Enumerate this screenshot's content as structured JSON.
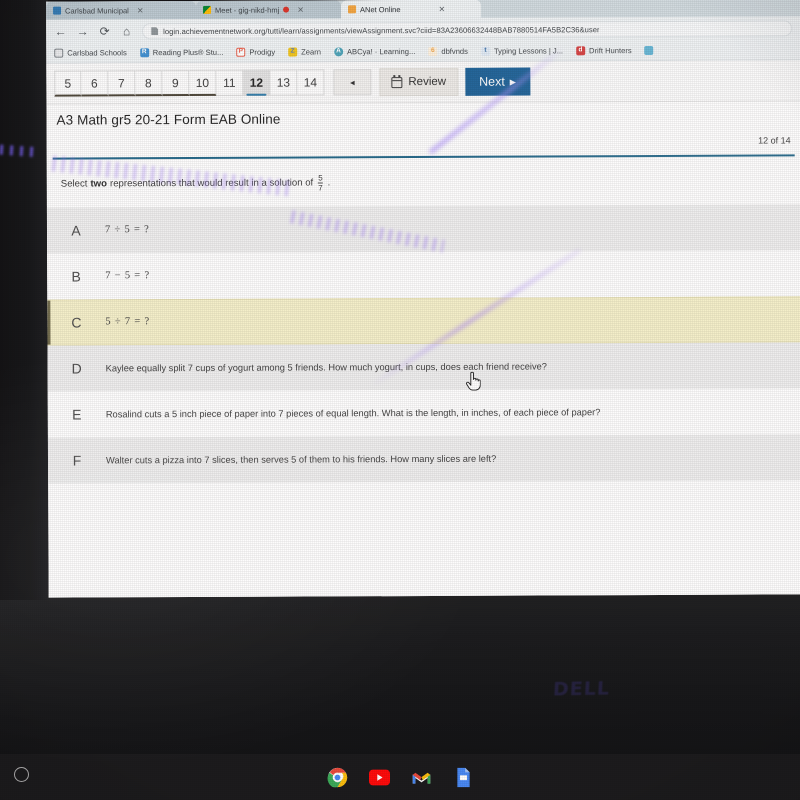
{
  "browser": {
    "tabs": [
      {
        "label": "Carlsbad Municipal",
        "favicon": "globe-icon",
        "active": false,
        "color": "#2f7ab5"
      },
      {
        "label": "Meet - gig-nikd-hmj",
        "favicon": "google-meet-icon",
        "active": false,
        "color": "#00832d",
        "recording_dot": true
      },
      {
        "label": "ANet Online",
        "favicon": "anet-icon",
        "active": true,
        "color": "#f2a33c"
      }
    ],
    "nav": {
      "back_icon": "back-arrow-icon",
      "forward_icon": "forward-arrow-icon",
      "reload_icon": "reload-icon",
      "home_icon": "home-icon"
    },
    "omnibox": {
      "page_info_icon": "page-info-icon",
      "url": "login.achievementnetwork.org/tutti/learn/assignments/viewAssignment.svc?ciid=83A23606632448BAB7880514FA5B2C36&user"
    },
    "bookmarks": [
      {
        "label": "Carlsbad Schools",
        "icon": "folder-icon",
        "color": "#6b7378",
        "glyph": ""
      },
      {
        "label": "Reading Plus® Stu...",
        "icon": "reading-plus-icon",
        "color": "#3d8fd1",
        "glyph": "R"
      },
      {
        "label": "Prodigy",
        "icon": "prodigy-icon",
        "color": "#e8604c",
        "glyph": "P"
      },
      {
        "label": "Zearn",
        "icon": "zearn-icon",
        "color": "#f0c419",
        "glyph": "Z"
      },
      {
        "label": "ABCya! · Learning...",
        "icon": "abcya-icon",
        "color": "#4aa3b8",
        "glyph": "A"
      },
      {
        "label": "dbfvnds",
        "icon": "dbfvnds-icon",
        "color": "#f3a84c",
        "glyph": "6"
      },
      {
        "label": "Typing Lessons | J...",
        "icon": "typing-lessons-icon",
        "color": "#4a90d9",
        "glyph": "t"
      },
      {
        "label": "Drift Hunters",
        "icon": "drift-hunters-icon",
        "color": "#d43c3c",
        "glyph": "d"
      },
      {
        "label": "",
        "icon": "extra-bookmark-icon",
        "color": "#5fb3d4",
        "glyph": ""
      }
    ]
  },
  "assignment": {
    "title": "A3 Math gr5 20-21 Form EAB Online",
    "counter": "12 of 14",
    "question_numbers": [
      {
        "label": "5",
        "state": "done"
      },
      {
        "label": "6",
        "state": "done"
      },
      {
        "label": "7",
        "state": "done"
      },
      {
        "label": "8",
        "state": "done"
      },
      {
        "label": "9",
        "state": "done"
      },
      {
        "label": "10",
        "state": "done"
      },
      {
        "label": "11",
        "state": "default"
      },
      {
        "label": "12",
        "state": "current"
      },
      {
        "label": "13",
        "state": "default"
      },
      {
        "label": "14",
        "state": "default"
      }
    ],
    "prev_button": {
      "label": "◂",
      "name": "previous-page-button"
    },
    "review_button": {
      "label": "Review",
      "icon": "calendar-grid-icon"
    },
    "next_button": {
      "label": "Next",
      "icon": "next-arrow-icon",
      "color": "#1a5f96"
    }
  },
  "question": {
    "stem_before": "Select",
    "stem_bold": "two",
    "stem_after": "representations that would result in a solution of",
    "fraction_numerator": "5",
    "fraction_denominator": "7",
    "stem_end": ".",
    "options": [
      {
        "letter": "A",
        "text": "7 ÷ 5 = ?",
        "style": "math",
        "row": "shade"
      },
      {
        "letter": "B",
        "text": "7 − 5 = ?",
        "style": "math",
        "row": "plain"
      },
      {
        "letter": "C",
        "text": "5 ÷ 7 = ?",
        "style": "math",
        "row": "hover"
      },
      {
        "letter": "D",
        "text": "Kaylee equally split 7 cups of yogurt among 5 friends. How much yogurt, in cups, does each friend receive?",
        "style": "prose",
        "row": "shade"
      },
      {
        "letter": "E",
        "text": "Rosalind cuts a 5 inch piece of paper into 7 pieces of equal length. What is the length, in inches, of each piece of paper?",
        "style": "prose",
        "row": "plain"
      },
      {
        "letter": "F",
        "text": "Walter cuts a pizza into 7 slices, then serves 5 of them to his friends. How many slices are left?",
        "style": "prose",
        "row": "shade"
      }
    ]
  },
  "cursor": {
    "type": "pointing-hand-cursor",
    "over_option": "C"
  },
  "shelf": {
    "launcher_icon": "launcher-circle-icon",
    "apps": [
      {
        "name": "chrome-icon",
        "label": "Chrome",
        "active": true
      },
      {
        "name": "youtube-icon",
        "label": "YouTube",
        "active": false
      },
      {
        "name": "gmail-icon",
        "label": "Gmail",
        "active": false
      },
      {
        "name": "slides-icon",
        "label": "Slides",
        "active": false
      }
    ]
  },
  "device": {
    "brand": "DELL"
  }
}
